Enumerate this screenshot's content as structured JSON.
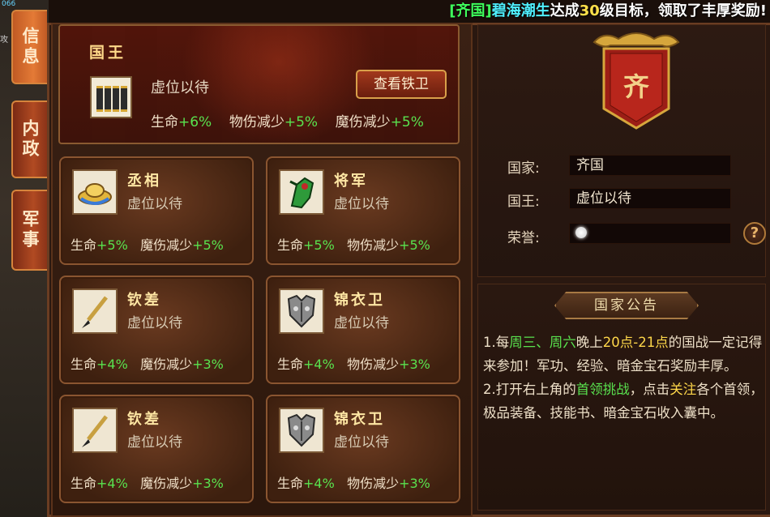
{
  "broadcast": {
    "bracket_open": "[",
    "country": "齐国",
    "bracket_close": "]",
    "player": "碧海潮生",
    "text1": "达成",
    "level": "30",
    "text2": "级目标，领取了丰厚奖励!"
  },
  "corner": {
    "line1": "066",
    "line2": "攻"
  },
  "side_tabs": [
    {
      "label": "信息",
      "active": true
    },
    {
      "label": "内政",
      "active": false
    },
    {
      "label": "军事",
      "active": false
    }
  ],
  "king": {
    "title": "国王",
    "vacant": "虚位以待",
    "stat_hp_label": "生命",
    "stat_hp_value": "+6%",
    "stat_phys_label": "物伤减少",
    "stat_phys_value": "+5%",
    "stat_magic_label": "魔伤减少",
    "stat_magic_value": "+5%",
    "view_button": "查看铁卫"
  },
  "officers": [
    {
      "name": "丞相",
      "vacant": "虚位以待",
      "hp_label": "生命",
      "hp": "+5%",
      "def_label": "魔伤减少",
      "def": "+5%",
      "icon": "gold-ingot-icon"
    },
    {
      "name": "将军",
      "vacant": "虚位以待",
      "hp_label": "生命",
      "hp": "+5%",
      "def_label": "物伤减少",
      "def": "+5%",
      "icon": "green-gauntlet-icon"
    },
    {
      "name": "钦差",
      "vacant": "虚位以待",
      "hp_label": "生命",
      "hp": "+4%",
      "def_label": "魔伤减少",
      "def": "+3%",
      "icon": "brush-icon"
    },
    {
      "name": "锦衣卫",
      "vacant": "虚位以待",
      "hp_label": "生命",
      "hp": "+4%",
      "def_label": "物伤减少",
      "def": "+3%",
      "icon": "armor-icon"
    },
    {
      "name": "钦差",
      "vacant": "虚位以待",
      "hp_label": "生命",
      "hp": "+4%",
      "def_label": "魔伤减少",
      "def": "+3%",
      "icon": "brush-icon"
    },
    {
      "name": "锦衣卫",
      "vacant": "虚位以待",
      "hp_label": "生命",
      "hp": "+4%",
      "def_label": "物伤减少",
      "def": "+3%",
      "icon": "armor-icon"
    }
  ],
  "nation": {
    "banner_char": "齐",
    "country_label": "国家:",
    "country_value": "齐国",
    "king_label": "国王:",
    "king_value": "虚位以待",
    "honor_label": "荣誉:",
    "help": "?"
  },
  "notice": {
    "title": "国家公告",
    "p1_a": "1.每",
    "p1_days": "周三、周六",
    "p1_b": "晚上",
    "p1_time": "20点-21点",
    "p1_c": "的国战一定记得来参加！军功、经验、暗金宝石奖励丰厚。",
    "p2_a": "2.打开右上角的",
    "p2_link": "首领挑战",
    "p2_b": "，点击",
    "p2_follow": "关注",
    "p2_c": "各个首领，极品装备、技能书、暗金宝石收入囊中。"
  },
  "colors": {
    "accent_green": "#59e24e",
    "accent_yellow": "#ffd84a",
    "panel_border": "#8a5530"
  }
}
